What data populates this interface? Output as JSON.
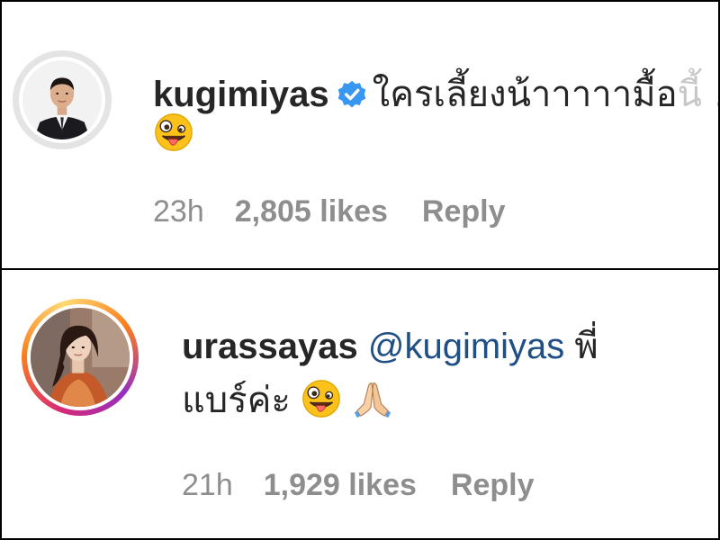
{
  "comments": [
    {
      "username": "kugimiyas",
      "verified": true,
      "text_line1": "ใครเลี้ยงน้าาาาามื้อ",
      "text_line1_faded": "นี้ .",
      "emoji_line2": [
        "zany-face"
      ],
      "time": "23h",
      "likes": "2,805 likes",
      "reply_label": "Reply"
    },
    {
      "username": "urassayas",
      "mention": "@kugimiyas",
      "text_line1_suffix": "พี่",
      "text_line2": "แบร์ค่ะ",
      "emoji_line2": [
        "zany-face",
        "folded-hands"
      ],
      "time": "21h",
      "likes": "1,929 likes",
      "reply_label": "Reply"
    }
  ],
  "colors": {
    "text": "#262626",
    "meta": "#8e8e8e",
    "mention": "#1f4f84",
    "verified_badge": "#3897f0"
  }
}
